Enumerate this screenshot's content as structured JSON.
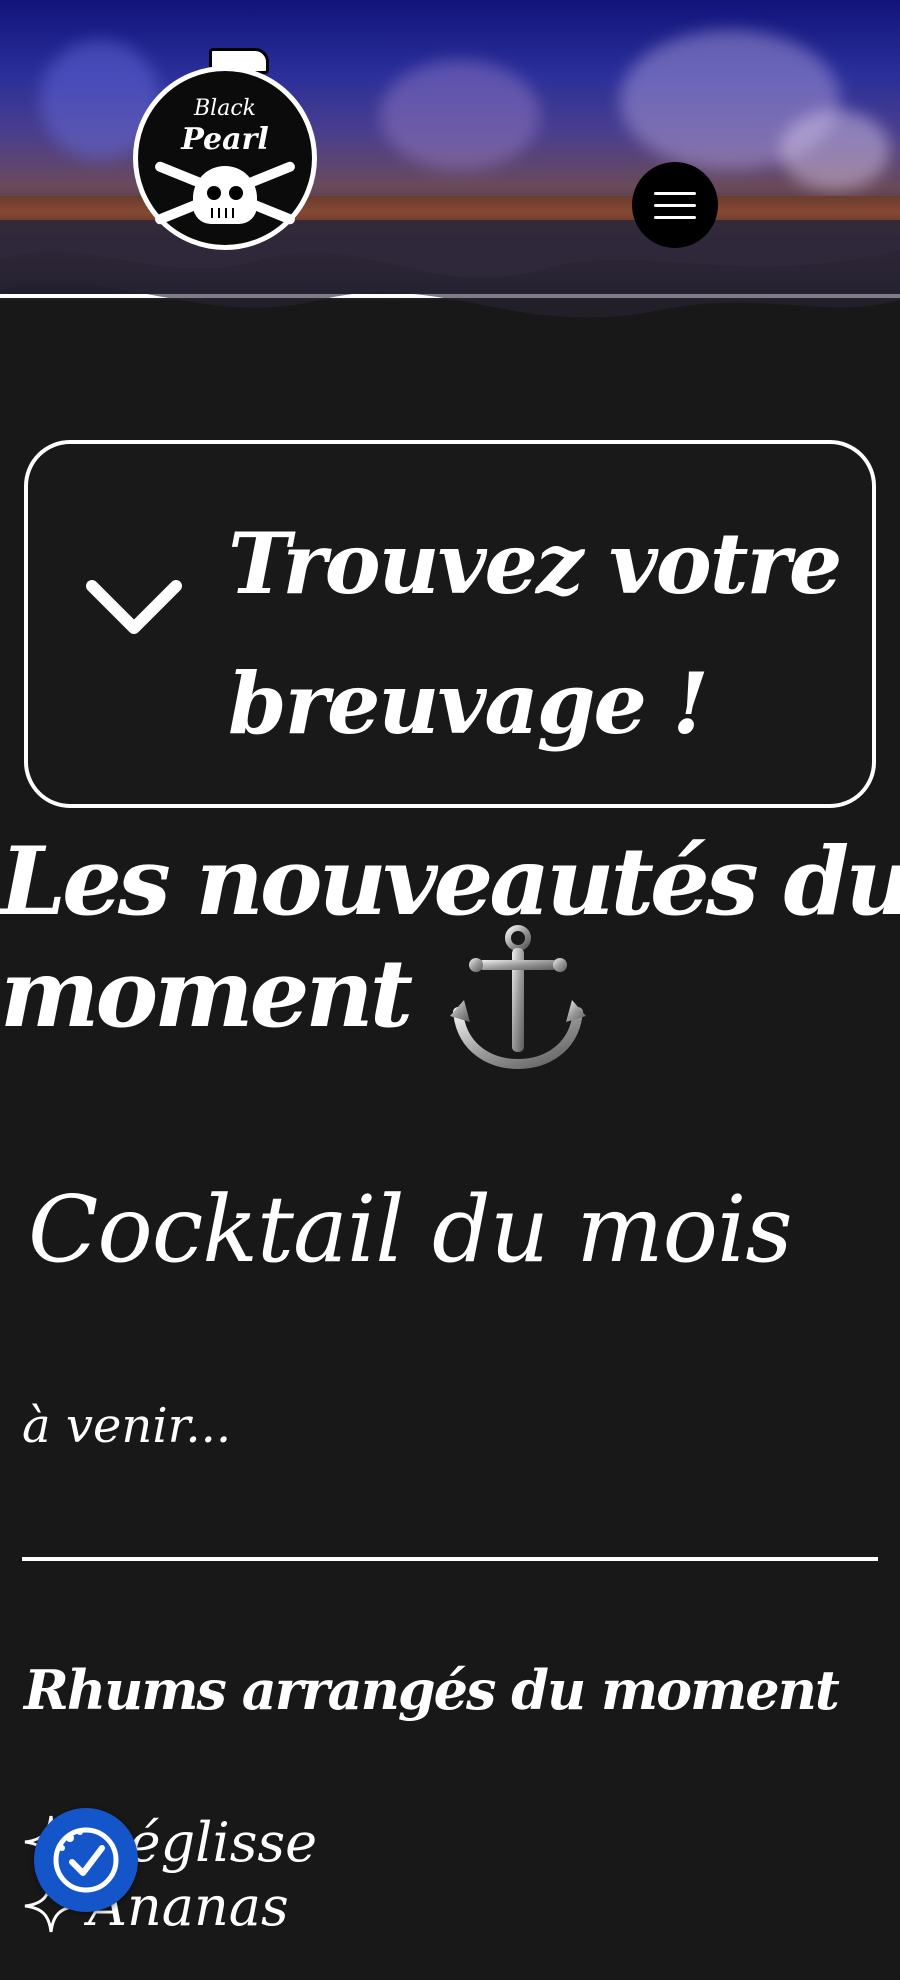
{
  "header": {
    "logo": {
      "line1": "Black",
      "line2": "Pearl"
    },
    "menu_button": {
      "icon": "hamburger-menu-icon"
    }
  },
  "finder": {
    "label": "Trouvez votre breuvage !",
    "icon": "chevron-down-icon"
  },
  "news": {
    "title_line1": "Les nouveautés du",
    "title_line2": "moment",
    "icon": "anchor-icon"
  },
  "cocktail": {
    "title": "Cocktail du mois",
    "text": "à venir..."
  },
  "rhums": {
    "title": "Rhums arrangés du moment",
    "items": [
      {
        "label": "Réglisse",
        "icon": "sparkle-icon"
      },
      {
        "label": "Ananas",
        "icon": "sparkle-icon"
      }
    ]
  },
  "accessibility": {
    "icon": "accessibility-check-icon"
  },
  "colors": {
    "background": "#181818",
    "text": "#ffffff",
    "accessibility_blue": "#1456c9"
  }
}
